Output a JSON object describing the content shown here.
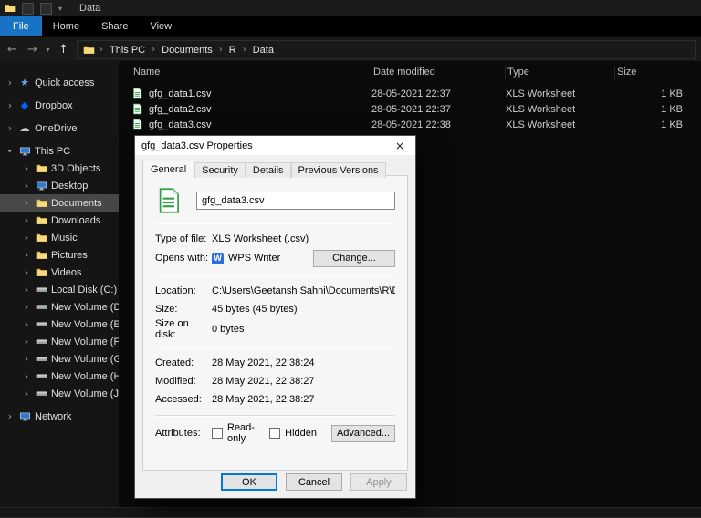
{
  "window": {
    "title": "Data",
    "ribbon_tabs": [
      "File",
      "Home",
      "Share",
      "View"
    ],
    "breadcrumb": [
      "This PC",
      "Documents",
      "R",
      "Data"
    ]
  },
  "file_list": {
    "columns": [
      "Name",
      "Date modified",
      "Type",
      "Size"
    ],
    "rows": [
      {
        "name": "gfg_data1.csv",
        "date_modified": "28-05-2021 22:37",
        "type": "XLS Worksheet",
        "size": "1 KB"
      },
      {
        "name": "gfg_data2.csv",
        "date_modified": "28-05-2021 22:37",
        "type": "XLS Worksheet",
        "size": "1 KB"
      },
      {
        "name": "gfg_data3.csv",
        "date_modified": "28-05-2021 22:38",
        "type": "XLS Worksheet",
        "size": "1 KB"
      }
    ]
  },
  "sidebar": {
    "items": [
      {
        "label": "Quick access"
      },
      {
        "label": "Dropbox"
      },
      {
        "label": "OneDrive"
      },
      {
        "label": "This PC"
      },
      {
        "label": "3D Objects"
      },
      {
        "label": "Desktop"
      },
      {
        "label": "Documents"
      },
      {
        "label": "Downloads"
      },
      {
        "label": "Music"
      },
      {
        "label": "Pictures"
      },
      {
        "label": "Videos"
      },
      {
        "label": "Local Disk (C:)"
      },
      {
        "label": "New Volume (D:)"
      },
      {
        "label": "New Volume (E:)"
      },
      {
        "label": "New Volume (F:)"
      },
      {
        "label": "New Volume (G:)"
      },
      {
        "label": "New Volume (H:)"
      },
      {
        "label": "New Volume (J:)"
      },
      {
        "label": "Network"
      }
    ]
  },
  "dialog": {
    "title": "gfg_data3.csv Properties",
    "tabs": [
      "General",
      "Security",
      "Details",
      "Previous Versions"
    ],
    "filename": "gfg_data3.csv",
    "type_of_file": {
      "label": "Type of file:",
      "value": "XLS Worksheet (.csv)"
    },
    "opens_with": {
      "label": "Opens with:",
      "value": "WPS Writer",
      "change_button": "Change...",
      "app_initial": "W"
    },
    "location": {
      "label": "Location:",
      "value": "C:\\Users\\Geetansh Sahni\\Documents\\R\\Data"
    },
    "size": {
      "label": "Size:",
      "value": "45 bytes (45 bytes)"
    },
    "size_on_disk": {
      "label": "Size on disk:",
      "value": "0 bytes"
    },
    "created": {
      "label": "Created:",
      "value": "28 May 2021, 22:38:24"
    },
    "modified": {
      "label": "Modified:",
      "value": "28 May 2021, 22:38:27"
    },
    "accessed": {
      "label": "Accessed:",
      "value": "28 May 2021, 22:38:27"
    },
    "attributes": {
      "label": "Attributes:",
      "readonly": "Read-only",
      "hidden": "Hidden",
      "advanced_button": "Advanced..."
    },
    "buttons": {
      "ok": "OK",
      "cancel": "Cancel",
      "apply": "Apply"
    }
  },
  "icons": {
    "back": "←",
    "forward": "→",
    "up": "↑",
    "dropdown": "▾",
    "chevron": "›",
    "close": "×",
    "star": "★",
    "cloud": "☁",
    "dropbox": "◆"
  },
  "colors": {
    "ribbon_file_tab": "#1873c5",
    "sidebar_selection": "#484848",
    "file_icon_green": "#2f9e44",
    "ok_button_focus": "#0078d7"
  }
}
